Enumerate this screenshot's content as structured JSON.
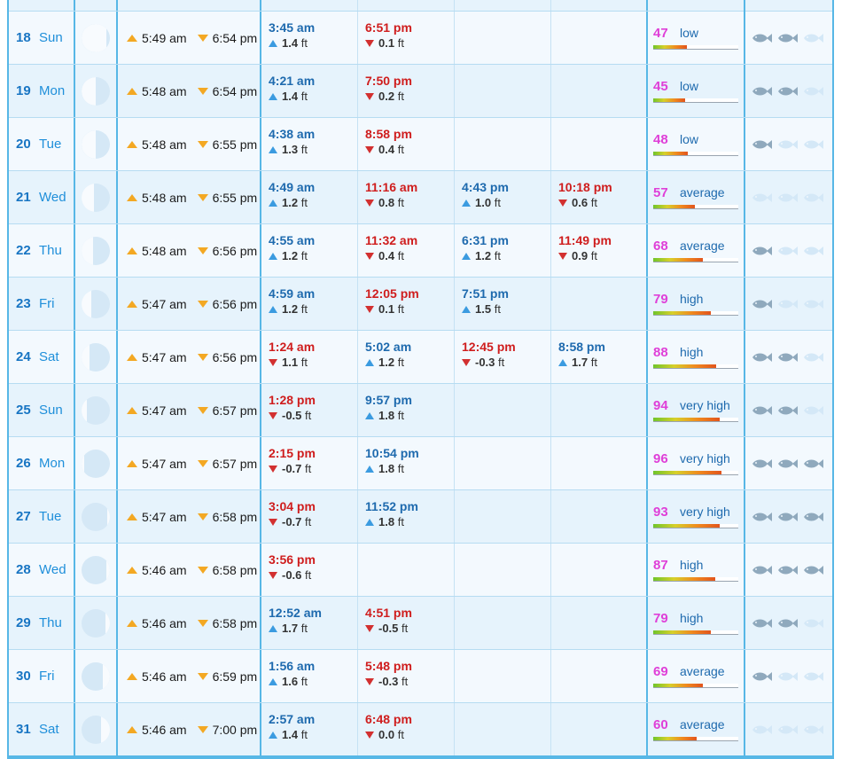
{
  "unit": "ft",
  "colors": {
    "accent": "#57b7e6",
    "high_tide": "#1e6aae",
    "low_tide": "#cf1d1d",
    "score": "#df3fd8"
  },
  "rows": [
    {
      "day": "18",
      "dow": "Sun",
      "moon": 0.88,
      "moon_side": "left",
      "rise": "5:49 am",
      "set": "6:54 pm",
      "tides": [
        {
          "t": "3:45 am",
          "type": "high",
          "h": "1.4"
        },
        {
          "t": "6:51 pm",
          "type": "low",
          "h": "0.1"
        }
      ],
      "score": "47",
      "label": "low",
      "fill": 0.4,
      "fish": 2
    },
    {
      "day": "19",
      "dow": "Mon",
      "moon": 0.5,
      "moon_side": "left",
      "rise": "5:48 am",
      "set": "6:54 pm",
      "tides": [
        {
          "t": "4:21 am",
          "type": "high",
          "h": "1.4"
        },
        {
          "t": "7:50 pm",
          "type": "low",
          "h": "0.2"
        }
      ],
      "score": "45",
      "label": "low",
      "fill": 0.38,
      "fish": 2
    },
    {
      "day": "20",
      "dow": "Tue",
      "moon": 0.5,
      "moon_side": "left",
      "rise": "5:48 am",
      "set": "6:55 pm",
      "tides": [
        {
          "t": "4:38 am",
          "type": "high",
          "h": "1.3"
        },
        {
          "t": "8:58 pm",
          "type": "low",
          "h": "0.4"
        }
      ],
      "score": "48",
      "label": "low",
      "fill": 0.41,
      "fish": 1
    },
    {
      "day": "21",
      "dow": "Wed",
      "moon": 0.45,
      "moon_side": "left",
      "rise": "5:48 am",
      "set": "6:55 pm",
      "tides": [
        {
          "t": "4:49 am",
          "type": "high",
          "h": "1.2"
        },
        {
          "t": "11:16 am",
          "type": "low",
          "h": "0.8"
        },
        {
          "t": "4:43 pm",
          "type": "high",
          "h": "1.0"
        },
        {
          "t": "10:18 pm",
          "type": "low",
          "h": "0.6"
        }
      ],
      "score": "57",
      "label": "average",
      "fill": 0.49,
      "fish": 0
    },
    {
      "day": "22",
      "dow": "Thu",
      "moon": 0.42,
      "moon_side": "left",
      "rise": "5:48 am",
      "set": "6:56 pm",
      "tides": [
        {
          "t": "4:55 am",
          "type": "high",
          "h": "1.2"
        },
        {
          "t": "11:32 am",
          "type": "low",
          "h": "0.4"
        },
        {
          "t": "6:31 pm",
          "type": "high",
          "h": "1.2"
        },
        {
          "t": "11:49 pm",
          "type": "low",
          "h": "0.9"
        }
      ],
      "score": "68",
      "label": "average",
      "fill": 0.58,
      "fish": 1
    },
    {
      "day": "23",
      "dow": "Fri",
      "moon": 0.35,
      "moon_side": "left",
      "rise": "5:47 am",
      "set": "6:56 pm",
      "tides": [
        {
          "t": "4:59 am",
          "type": "high",
          "h": "1.2"
        },
        {
          "t": "12:05 pm",
          "type": "low",
          "h": "0.1"
        },
        {
          "t": "7:51 pm",
          "type": "high",
          "h": "1.5"
        }
      ],
      "score": "79",
      "label": "high",
      "fill": 0.68,
      "fish": 1
    },
    {
      "day": "24",
      "dow": "Sat",
      "moon": 0.28,
      "moon_side": "left",
      "rise": "5:47 am",
      "set": "6:56 pm",
      "tides": [
        {
          "t": "1:24 am",
          "type": "low",
          "h": "1.1"
        },
        {
          "t": "5:02 am",
          "type": "high",
          "h": "1.2"
        },
        {
          "t": "12:45 pm",
          "type": "low",
          "h": "-0.3"
        },
        {
          "t": "8:58 pm",
          "type": "high",
          "h": "1.7"
        }
      ],
      "score": "88",
      "label": "high",
      "fill": 0.74,
      "fish": 2
    },
    {
      "day": "25",
      "dow": "Sun",
      "moon": 0.2,
      "moon_side": "left",
      "rise": "5:47 am",
      "set": "6:57 pm",
      "tides": [
        {
          "t": "1:28 pm",
          "type": "low",
          "h": "-0.5"
        },
        {
          "t": "9:57 pm",
          "type": "high",
          "h": "1.8"
        }
      ],
      "score": "94",
      "label": "very high",
      "fill": 0.78,
      "fish": 2
    },
    {
      "day": "26",
      "dow": "Mon",
      "moon": 0.1,
      "moon_side": "left",
      "rise": "5:47 am",
      "set": "6:57 pm",
      "tides": [
        {
          "t": "2:15 pm",
          "type": "low",
          "h": "-0.7"
        },
        {
          "t": "10:54 pm",
          "type": "high",
          "h": "1.8"
        }
      ],
      "score": "96",
      "label": "very high",
      "fill": 0.8,
      "fish": 3
    },
    {
      "day": "27",
      "dow": "Tue",
      "moon": 0.08,
      "moon_side": "right",
      "rise": "5:47 am",
      "set": "6:58 pm",
      "tides": [
        {
          "t": "3:04 pm",
          "type": "low",
          "h": "-0.7"
        },
        {
          "t": "11:52 pm",
          "type": "high",
          "h": "1.8"
        }
      ],
      "score": "93",
      "label": "very high",
      "fill": 0.78,
      "fish": 3
    },
    {
      "day": "28",
      "dow": "Wed",
      "moon": 0.12,
      "moon_side": "right",
      "rise": "5:46 am",
      "set": "6:58 pm",
      "tides": [
        {
          "t": "3:56 pm",
          "type": "low",
          "h": "-0.6"
        }
      ],
      "score": "87",
      "label": "high",
      "fill": 0.73,
      "fish": 3
    },
    {
      "day": "29",
      "dow": "Thu",
      "moon": 0.15,
      "moon_side": "right",
      "rise": "5:46 am",
      "set": "6:58 pm",
      "tides": [
        {
          "t": "12:52 am",
          "type": "high",
          "h": "1.7"
        },
        {
          "t": "4:51 pm",
          "type": "low",
          "h": "-0.5"
        }
      ],
      "score": "79",
      "label": "high",
      "fill": 0.68,
      "fish": 2
    },
    {
      "day": "30",
      "dow": "Fri",
      "moon": 0.25,
      "moon_side": "right",
      "rise": "5:46 am",
      "set": "6:59 pm",
      "tides": [
        {
          "t": "1:56 am",
          "type": "high",
          "h": "1.6"
        },
        {
          "t": "5:48 pm",
          "type": "low",
          "h": "-0.3"
        }
      ],
      "score": "69",
      "label": "average",
      "fill": 0.58,
      "fish": 1
    },
    {
      "day": "31",
      "dow": "Sat",
      "moon": 0.3,
      "moon_side": "right",
      "rise": "5:46 am",
      "set": "7:00 pm",
      "tides": [
        {
          "t": "2:57 am",
          "type": "high",
          "h": "1.4"
        },
        {
          "t": "6:48 pm",
          "type": "low",
          "h": "0.0"
        }
      ],
      "score": "60",
      "label": "average",
      "fill": 0.51,
      "fish": 0
    }
  ]
}
